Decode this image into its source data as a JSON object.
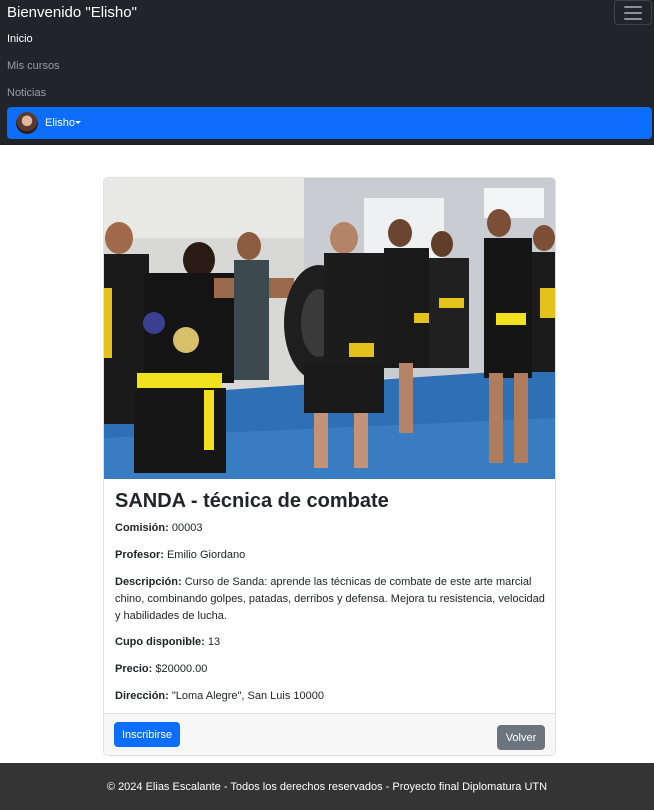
{
  "navbar": {
    "brand": "Bienvenido \"Elisho\"",
    "links": {
      "home": "Inicio",
      "courses": "Mis cursos",
      "news": "Noticias"
    },
    "user": {
      "name": "Elisho"
    }
  },
  "course": {
    "title": "SANDA - técnica de combate",
    "commission_label": "Comisión:",
    "commission": "00003",
    "teacher_label": "Profesor:",
    "teacher": "Emilio Giordano",
    "description_label": "Descripción:",
    "description": "Curso de Sanda: aprende las técnicas de combate de este arte marcial chino, combinando golpes, patadas, derribos y defensa. Mejora tu resistencia, velocidad y habilidades de lucha.",
    "slots_label": "Cupo disponible:",
    "slots": "13",
    "price_label": "Precio:",
    "price": "$20000.00",
    "address_label": "Dirección:",
    "address": "\"Loma Alegre\", San Luis 10000"
  },
  "actions": {
    "enroll": "Inscribirse",
    "back": "Volver"
  },
  "footer": {
    "text": "© 2024 Elias Escalante - Todos los derechos reservados - Proyecto final Diplomatura UTN"
  },
  "colors": {
    "navbar_bg": "#212529",
    "primary": "#0d6efd",
    "secondary": "#6c757d",
    "footer_bg": "#343434"
  }
}
